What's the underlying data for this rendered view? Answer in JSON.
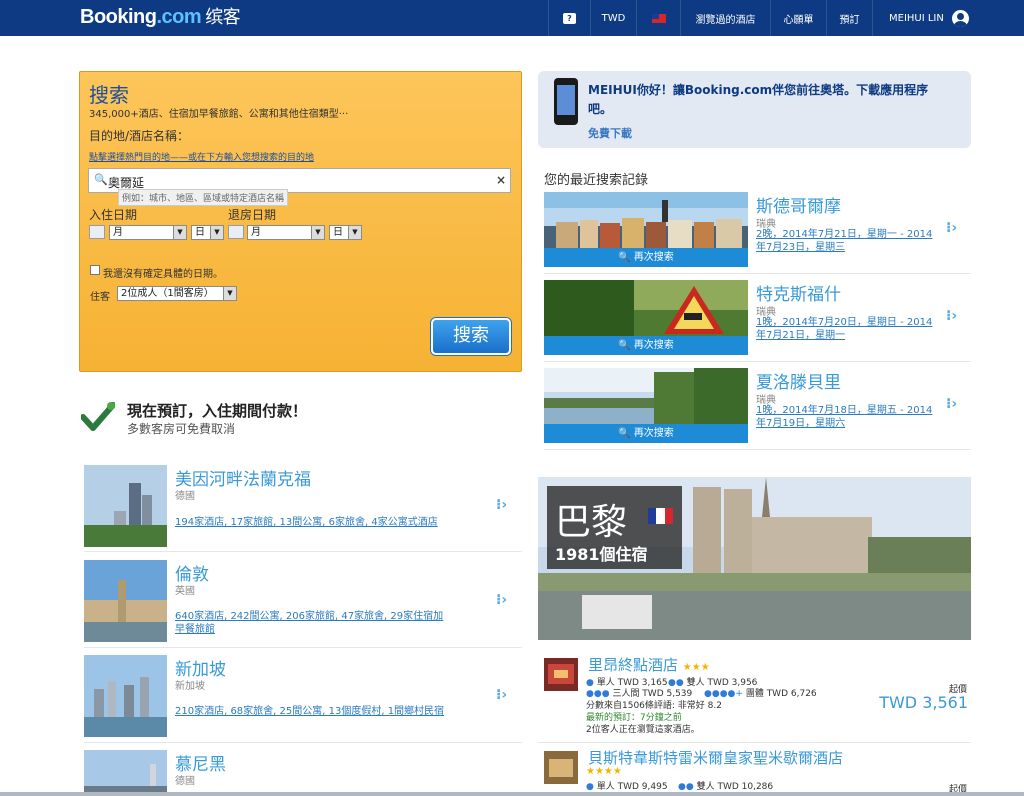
{
  "header": {
    "logo_main": "Booking",
    "logo_dot": ".com",
    "logo_cn": "缤客",
    "help": "?",
    "currency": "TWD",
    "recently_viewed": "瀏覽過的酒店",
    "wishlist": "心願單",
    "bookings": "預訂",
    "user": "MEIHUI LIN"
  },
  "search": {
    "title": "搜索",
    "subtitle": "345,000+酒店、住宿加早餐旅館、公寓和其他住宿類型···",
    "dest_label": "目的地/酒店名稱：",
    "dest_hint": "點擊選擇熱門目的地——或在下方輸入您想搜索的目的地",
    "dest_value": "奧爾延",
    "dest_placeholder": "例如：城市、地區、區域或特定酒店名稱",
    "checkin_label": "入住日期",
    "checkout_label": "退房日期",
    "month": "月",
    "day": "日",
    "no_dates": "我還沒有確定具體的日期。",
    "guests_label": "住客",
    "guests_value": "2位成人（1間客房）",
    "button": "搜索"
  },
  "promo": {
    "text": "MEIHUI你好！讓Booking.com伴您前往奧塔。下載應用程序吧。",
    "link": "免費下載"
  },
  "recent": {
    "heading": "您的最近搜索記錄",
    "button": "再次搜索",
    "items": [
      {
        "city": "斯德哥爾摩",
        "country": "瑞典",
        "dates": "2晚，2014年7月21日，星期一 - 2014年7月23日，星期三"
      },
      {
        "city": "特克斯福什",
        "country": "瑞典",
        "dates": "1晚，2014年7月20日，星期日 - 2014年7月21日，星期一"
      },
      {
        "city": "夏洛滕貝里",
        "country": "瑞典",
        "dates": "1晚，2014年7月18日，星期五 - 2014年7月19日，星期六"
      }
    ]
  },
  "pay": {
    "title": "現在預訂，入住期間付款！",
    "subtitle": "多數客房可免費取消"
  },
  "destinations": [
    {
      "name": "美因河畔法蘭克福",
      "country": "德國",
      "links": "194家酒店, 17家旅館, 13間公寓, 6家旅舍, 4家公寓式酒店"
    },
    {
      "name": "倫敦",
      "country": "英國",
      "links": "640家酒店, 242間公寓, 206家旅館, 47家旅舍, 29家住宿加早餐旅館"
    },
    {
      "name": "新加坡",
      "country": "新加坡",
      "links": "210家酒店, 68家旅舍, 25間公寓, 13個度假村, 1間鄉村民宿"
    },
    {
      "name": "慕尼黑",
      "country": "德國",
      "links": ""
    }
  ],
  "paris": {
    "city": "巴黎",
    "count": "1981個住宿"
  },
  "hotels": [
    {
      "name": "里昂終點酒店",
      "single": "單人 TWD 3,165",
      "double": "雙人 TWD 3,956",
      "triple": "三人間 TWD 5,539",
      "group": "團體 TWD 6,726",
      "reviews": "分數來自1506條評語: 非常好 8.2",
      "latest": "最新的預訂：7分鐘之前",
      "viewing": "2位客人正在瀏覽這家酒店。",
      "from_label": "起價",
      "price": "TWD 3,561"
    },
    {
      "name": "貝斯特韋斯特雷米爾皇家聖米歇爾酒店",
      "single": "單人 TWD 9,495",
      "double": "雙人 TWD 10,286",
      "from_label": "起價"
    }
  ],
  "colors": {
    "brand": "#0d3a82",
    "accent": "#3a9ad8",
    "searchbox": "#fdbd4a"
  }
}
